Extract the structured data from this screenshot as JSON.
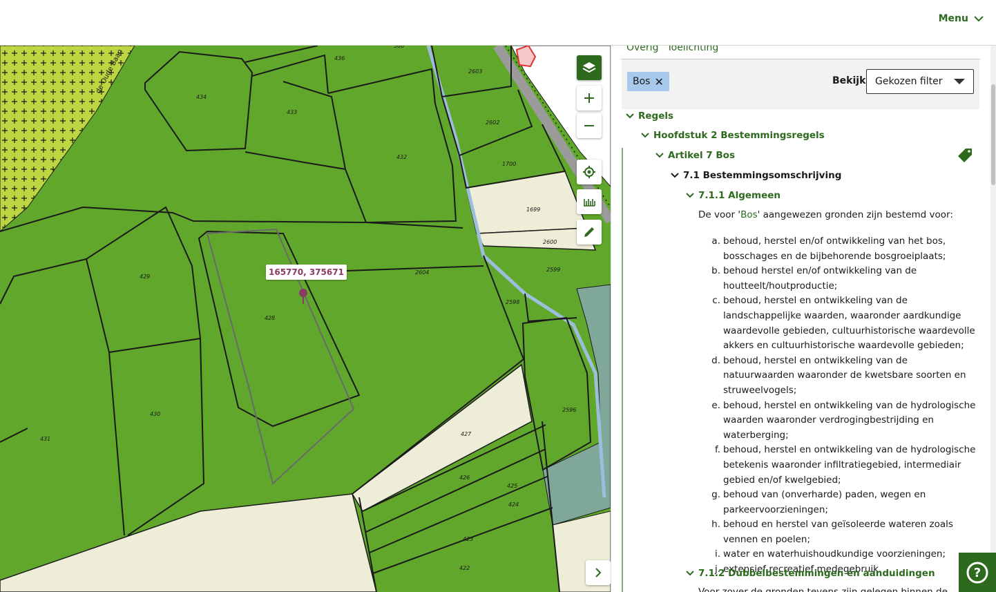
{
  "header": {
    "menu_label": "Menu"
  },
  "map": {
    "coordinate_label": "165770, 375671",
    "road_label": "de Oude Baan",
    "parcels": [
      {
        "id": "p434",
        "label": "434"
      },
      {
        "id": "p436",
        "label": "436"
      },
      {
        "id": "p506",
        "label": "506"
      },
      {
        "id": "p433",
        "label": "433"
      },
      {
        "id": "p432",
        "label": "432"
      },
      {
        "id": "p2603",
        "label": "2603"
      },
      {
        "id": "p2602",
        "label": "2602"
      },
      {
        "id": "p1700",
        "label": "1700"
      },
      {
        "id": "p1699",
        "label": "1699"
      },
      {
        "id": "p2600",
        "label": "2600"
      },
      {
        "id": "p2599",
        "label": "2599"
      },
      {
        "id": "p2604",
        "label": "2604"
      },
      {
        "id": "p2598",
        "label": "2598"
      },
      {
        "id": "p429",
        "label": "429"
      },
      {
        "id": "p428",
        "label": "428"
      },
      {
        "id": "p430",
        "label": "430"
      },
      {
        "id": "p431",
        "label": "431"
      },
      {
        "id": "p427",
        "label": "427"
      },
      {
        "id": "p2596",
        "label": "2596"
      },
      {
        "id": "p426",
        "label": "426"
      },
      {
        "id": "p425",
        "label": "425"
      },
      {
        "id": "p424",
        "label": "424"
      },
      {
        "id": "p423",
        "label": "423"
      },
      {
        "id": "p422",
        "label": "422"
      }
    ],
    "colors": {
      "forest": "#60a72b",
      "agri": "#eeeed8",
      "water": "#7fa79a",
      "nature": "#bcd641"
    }
  },
  "panel": {
    "tabs": [
      "Overig",
      "Toelichting"
    ],
    "filter_chip": "Bos",
    "bekijk_label": "Bekijk:",
    "bekijk_value": "Gekozen filter",
    "tree": {
      "regels": "Regels",
      "hoofdstuk": "Hoofdstuk 2 Bestemmingsregels",
      "artikel": "Artikel 7 Bos",
      "section": "7.1 Bestemmingsomschrijving",
      "sub1": "7.1.1 Algemeen",
      "sub2": "7.1.2 Dubbelbestemmingen en aanduidingen"
    },
    "intro_pre": "De voor '",
    "intro_link": "Bos",
    "intro_post": "' aangewezen gronden zijn bestemd voor:",
    "list": [
      {
        "marker": "a.",
        "text": "behoud, herstel en/of ontwikkeling van het bos, bosschages en de bijbehorende bosgroeiplaats;"
      },
      {
        "marker": "b.",
        "text": "behoud herstel en/of ontwikkeling van de houtteelt/houtproductie;"
      },
      {
        "marker": "c.",
        "text": "behoud, herstel en ontwikkeling van de landschappelijke waarden, waaronder aardkundige waardevolle gebieden, cultuurhistorische waardevolle akkers en cultuurhistorische waardevolle gebieden;"
      },
      {
        "marker": "d.",
        "text": "behoud, herstel en ontwikkeling van de natuurwaarden waaronder de kwetsbare soorten en struweelvogels;"
      },
      {
        "marker": "e.",
        "text": "behoud, herstel en ontwikkeling van de hydrologische waarden waaronder verdrogingbestrijding en waterberging;"
      },
      {
        "marker": "f.",
        "text": "behoud, herstel en ontwikkeling van de hydrologische betekenis waaronder infiltratiegebied, intermediair gebied en/of kwelgebied;"
      },
      {
        "marker": "g.",
        "text": "behoud van (onverharde) paden, wegen en parkeervoorzieningen;"
      },
      {
        "marker": "h.",
        "text": "behoud en herstel van geïsoleerde wateren zoals vennen en poelen;"
      },
      {
        "marker": "i.",
        "text": "water en waterhuishoudkundige voorzieningen;"
      },
      {
        "marker": "j.",
        "text": "extensief recreatief medegebruik."
      }
    ],
    "partial_text": "Voor zover de gronden tevens zijn gelegen binnen de"
  }
}
